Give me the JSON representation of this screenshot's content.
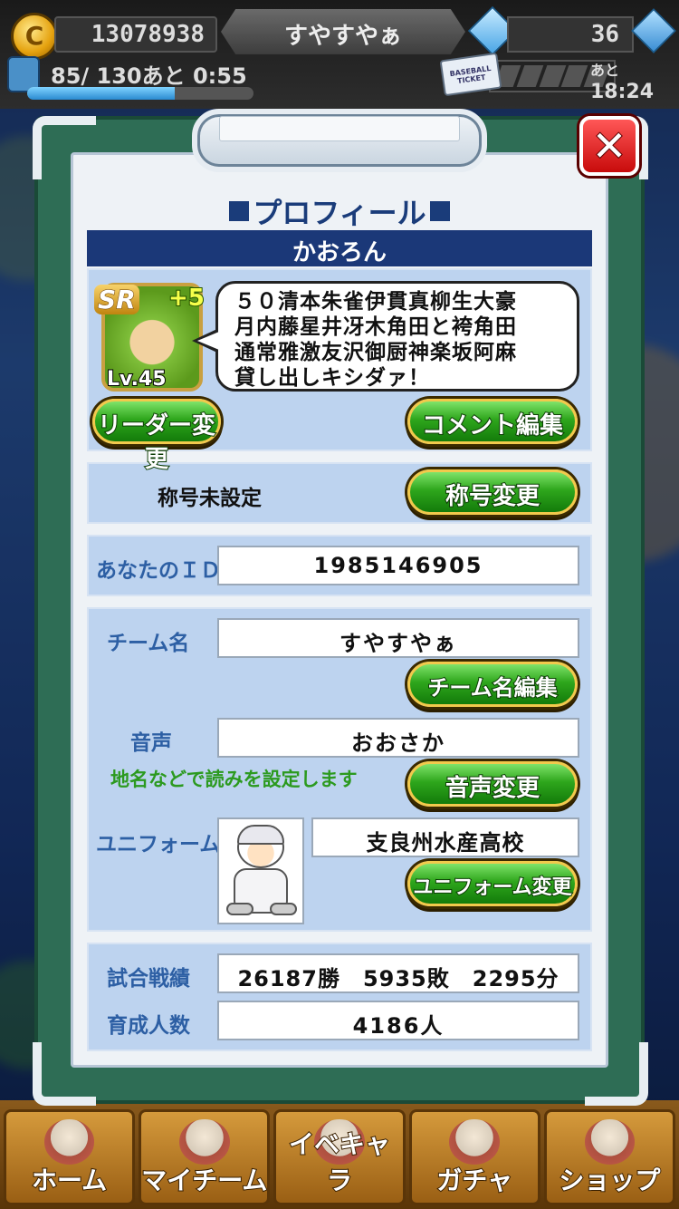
{
  "status_bar": {
    "coins": "13078938",
    "team_name": "すやすやぁ",
    "gems": "36",
    "stamina": "85/ 130あと 0:55",
    "stamina_fraction": 0.65,
    "ticket_time_prefix": "あと",
    "ticket_time": "18:24",
    "ticket_label": "BASEBALL TICKET"
  },
  "modal": {
    "title": "プロフィール",
    "player_name": "かおろん",
    "leader": {
      "rarity": "SR",
      "plus": "+5",
      "level": "Lv.45"
    },
    "comment_lines": [
      "５０清本朱雀伊貫真柳生大豪",
      "月内藤星井冴木角田と袴角田",
      "通常雅激友沢御厨神楽坂阿麻",
      "貸し出しキシダァ！"
    ],
    "leader_change_button": "リーダー変更",
    "comment_edit_button": "コメント編集",
    "title_status": "称号未設定",
    "title_change_button": "称号変更",
    "id_label": "あなたのＩＤ",
    "id_value": "1985146905",
    "team_label": "チーム名",
    "team_value": "すやすやぁ",
    "team_edit_button": "チーム名編集",
    "voice_label": "音声",
    "voice_value": "おおさか",
    "voice_hint": "地名などで読みを設定します",
    "voice_change_button": "音声変更",
    "uniform_label": "ユニフォーム",
    "uniform_value": "支良州水産高校",
    "uniform_change_button": "ユニフォーム変更",
    "record_label": "試合戦績",
    "record_value": "26187勝　5935敗　2295分",
    "trained_label": "育成人数",
    "trained_value": "4186人"
  },
  "bottom_nav": [
    {
      "label": "ホーム"
    },
    {
      "label": "マイチーム"
    },
    {
      "label": "イベキャラ"
    },
    {
      "label": "ガチャ"
    },
    {
      "label": "ショップ"
    }
  ],
  "colors": {
    "accent_blue": "#1b3878",
    "label_blue": "#2d5fa4",
    "button_green": "#2ea61c",
    "close_red": "#d81515",
    "hint_green": "#2c9a1f"
  }
}
